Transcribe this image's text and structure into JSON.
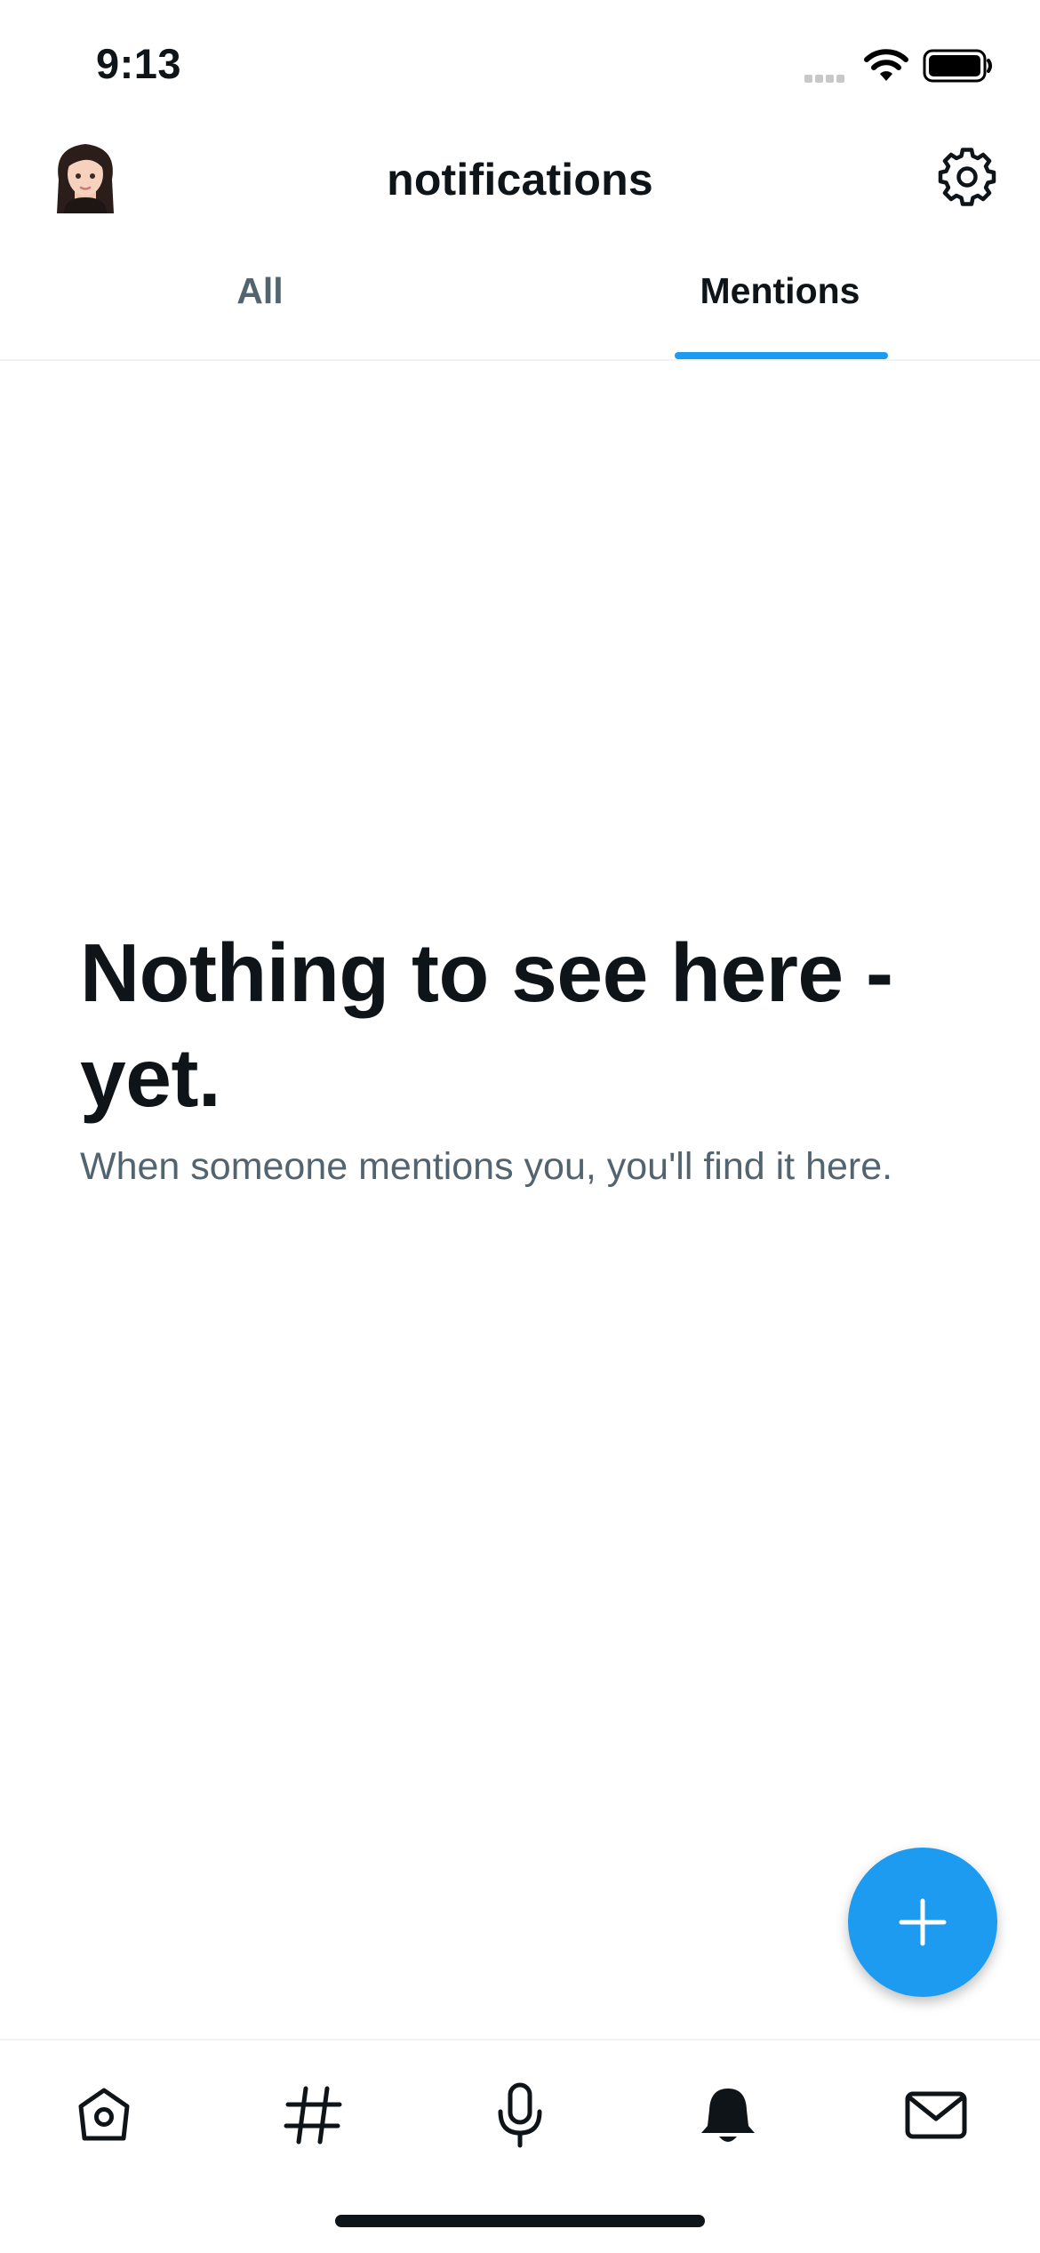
{
  "status_bar": {
    "time": "9:13",
    "icons": [
      "cellular-signal-icon",
      "wifi-icon",
      "battery-icon"
    ]
  },
  "header": {
    "title": "notifications",
    "avatar_icon": "memoji-avatar",
    "settings_icon": "gear-icon"
  },
  "tabs": [
    {
      "label": "All",
      "selected": false
    },
    {
      "label": "Mentions",
      "selected": true
    }
  ],
  "empty_state": {
    "title": "Nothing to see here - yet.",
    "subtitle": "When someone mentions you, you'll find it here."
  },
  "fab": {
    "icon": "plus-icon"
  },
  "tab_bar": {
    "items": [
      {
        "icon": "home-icon"
      },
      {
        "icon": "hashtag-icon"
      },
      {
        "icon": "microphone-icon"
      },
      {
        "icon": "bell-icon",
        "active": true
      },
      {
        "icon": "mail-icon"
      }
    ]
  },
  "colors": {
    "accent": "#1d9bf0",
    "text_primary": "#0f1419",
    "text_secondary": "#536471",
    "divider": "#eff3f4"
  }
}
